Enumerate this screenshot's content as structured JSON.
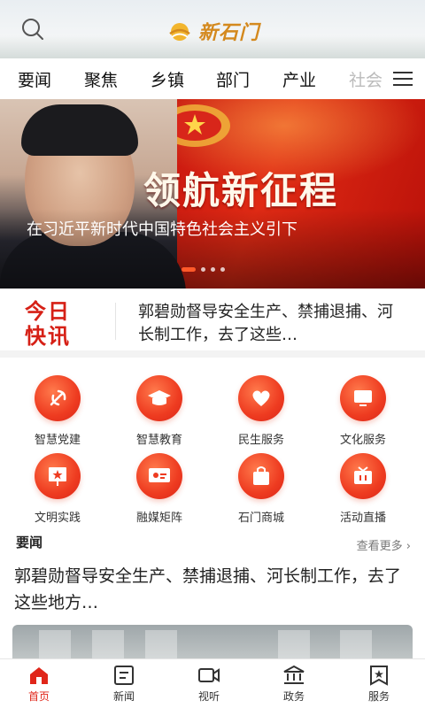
{
  "header": {
    "logo_text": "新石门"
  },
  "tabs": [
    "要闻",
    "聚焦",
    "乡镇",
    "部门",
    "产业",
    "社会"
  ],
  "banner": {
    "slogan": "领航新征程",
    "caption": "在习近平新时代中国特色社会主义引下"
  },
  "quick_news": {
    "badge_line1": "今日",
    "badge_line2": "快讯",
    "headline": "郭碧勋督导安全生产、禁捕退捕、河长制工作，去了这些…"
  },
  "services": [
    {
      "label": "智慧党建",
      "icon": "party-emblem-icon"
    },
    {
      "label": "智慧教育",
      "icon": "graduation-cap-icon"
    },
    {
      "label": "民生服务",
      "icon": "heart-icon"
    },
    {
      "label": "文化服务",
      "icon": "monitor-icon"
    },
    {
      "label": "文明实践",
      "icon": "star-board-icon"
    },
    {
      "label": "融媒矩阵",
      "icon": "media-screen-icon"
    },
    {
      "label": "石门商城",
      "icon": "shopping-bag-icon"
    },
    {
      "label": "活动直播",
      "icon": "tv-icon"
    }
  ],
  "news_section": {
    "title": "要闻",
    "more": "查看更多 ›",
    "headline": "郭碧勋督导安全生产、禁捕退捕、河长制工作，去了这些地方…"
  },
  "bottom_nav": [
    {
      "label": "首页",
      "icon": "home-icon",
      "active": true
    },
    {
      "label": "新闻",
      "icon": "news-icon",
      "active": false
    },
    {
      "label": "视听",
      "icon": "video-icon",
      "active": false
    },
    {
      "label": "政务",
      "icon": "government-icon",
      "active": false
    },
    {
      "label": "服务",
      "icon": "service-icon",
      "active": false
    }
  ],
  "colors": {
    "accent": "#e0261a",
    "banner_red": "#c7160f",
    "logo_gold": "#d4891e"
  }
}
